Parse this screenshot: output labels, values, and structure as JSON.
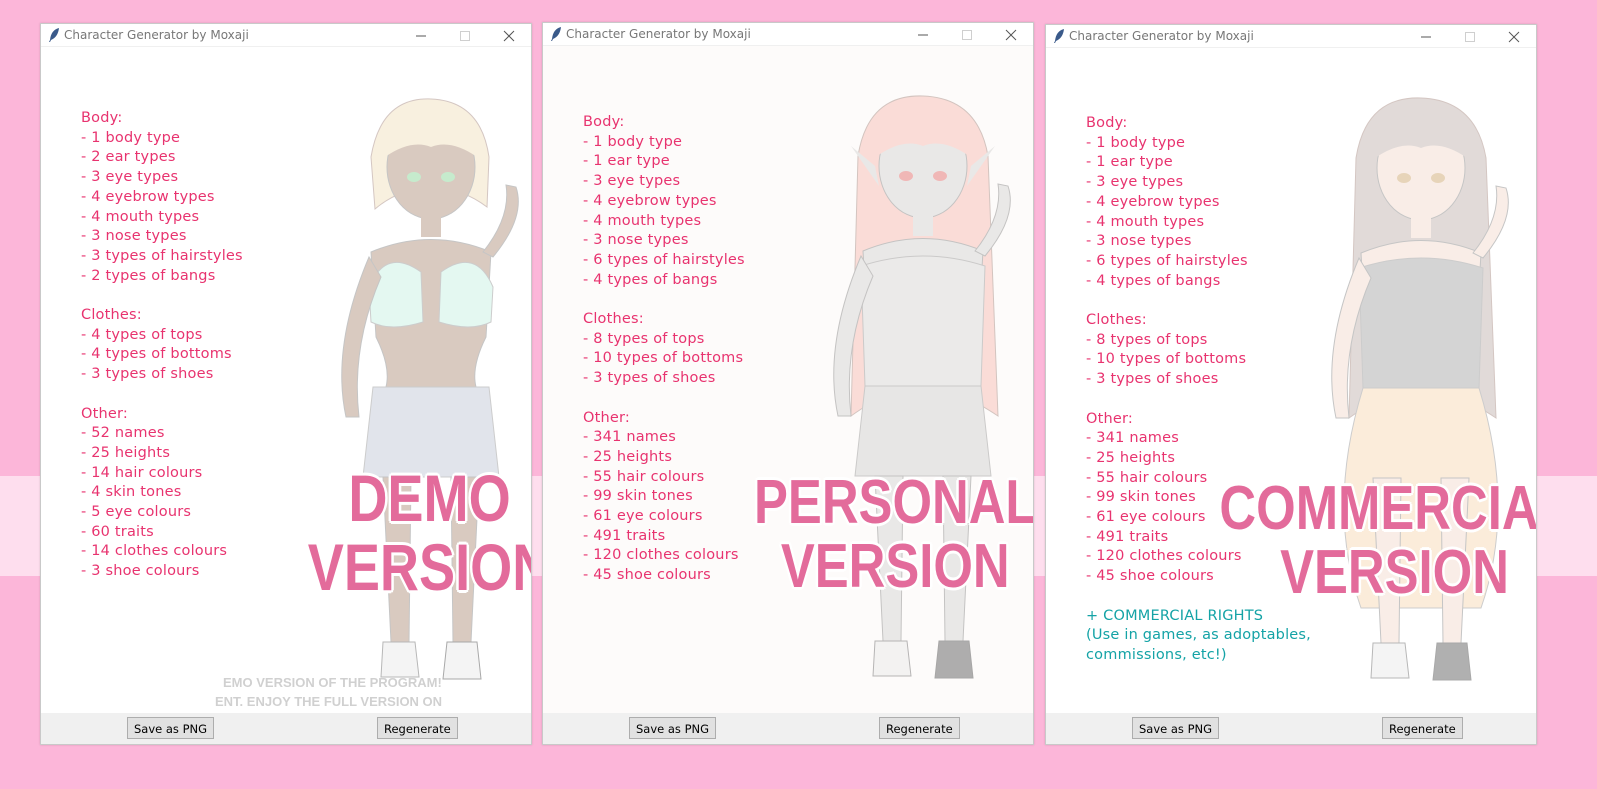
{
  "app": {
    "title": "Character Generator by Moxaji"
  },
  "buttons": {
    "save": "Save as PNG",
    "regenerate": "Regenerate"
  },
  "windows": [
    {
      "overlay": [
        "DEMO",
        "VERSION"
      ],
      "body_heading": "Body:",
      "body": [
        "- 1 body type",
        "- 2 ear types",
        "- 3 eye types",
        "- 4 eyebrow types",
        "- 4 mouth types",
        "- 3 nose types",
        "- 3 types of hairstyles",
        "- 2 types of bangs"
      ],
      "clothes_heading": "Clothes:",
      "clothes": [
        "- 4 types of tops",
        "- 4 types of bottoms",
        "- 3 types of shoes"
      ],
      "other_heading": "Other:",
      "other": [
        "- 52 names",
        "- 25 heights",
        "- 14 hair colours",
        "- 4 skin tones",
        "- 5 eye colours",
        "- 60 traits",
        "- 14 clothes colours",
        "- 3 shoe colours"
      ],
      "watermark": [
        "EMO VERSION OF THE PROGRAM!",
        "ENT. ENJOY THE FULL VERSION ON"
      ],
      "colors": {
        "hair": "#efdcb4",
        "skin": "#a7826b",
        "top": "#bff0e0",
        "bottom": "#b9bfd0",
        "eye": "#7ad18a"
      }
    },
    {
      "overlay": [
        "PERSONAL",
        "VERSION"
      ],
      "body_heading": "Body:",
      "body": [
        "- 1 body type",
        "- 1 ear type",
        "- 3 eye types",
        "- 4 eyebrow types",
        "- 4 mouth types",
        "- 3 nose types",
        "- 6 types of hairstyles",
        "- 4 types of bangs"
      ],
      "clothes_heading": "Clothes:",
      "clothes": [
        "- 8 types of tops",
        "- 10 types of bottoms",
        "- 3 types of shoes"
      ],
      "other_heading": "Other:",
      "other": [
        "- 341 names",
        "- 25 heights",
        "- 55 hair colours",
        "- 99 skin tones",
        "- 61 eye colours",
        "- 491 traits",
        "- 120 clothes colours",
        "- 45 shoe colours"
      ],
      "colors": {
        "hair": "#f7b3a8",
        "skin": "#cfcfcf",
        "top": "#d4d4d4",
        "bottom": "#cacaca",
        "eye": "#e05a5a"
      }
    },
    {
      "overlay": [
        "COMMERCIAL",
        "VERSION"
      ],
      "body_heading": "Body:",
      "body": [
        "- 1 body type",
        "- 1 ear type",
        "- 3 eye types",
        "- 4 eyebrow types",
        "- 4 mouth types",
        "- 3 nose types",
        "- 6 types of hairstyles",
        "- 4 types of bangs"
      ],
      "clothes_heading": "Clothes:",
      "clothes": [
        "- 8 types of tops",
        "- 10 types of bottoms",
        "- 3 types of shoes"
      ],
      "other_heading": "Other:",
      "other": [
        "- 341 names",
        "- 25 heights",
        "- 55 hair colours",
        "- 99 skin tones",
        "- 61 eye colours",
        "- 491 traits",
        "- 120 clothes colours",
        "- 45 shoe colours"
      ],
      "rights": [
        "+ COMMERCIAL RIGHTS",
        "(Use in games, as adoptables,",
        "commissions, etc!)"
      ],
      "colors": {
        "hair": "#b8a8a4",
        "skin": "#f2d6c8",
        "top": "#9a9a9a",
        "bottom": "#f7d2a8",
        "eye": "#c89a5a"
      }
    }
  ]
}
